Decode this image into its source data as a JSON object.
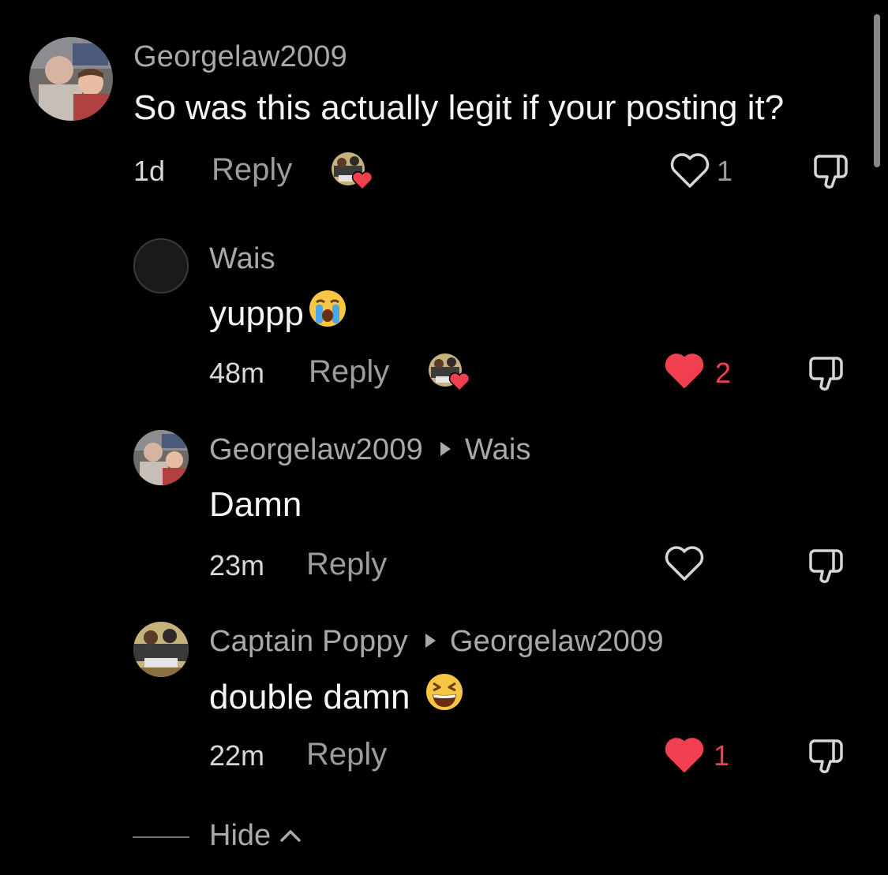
{
  "comments": [
    {
      "username": "Georgelaw2009",
      "reply_to": "",
      "text": "So was this actually legit if your posting it?",
      "emoji": "",
      "time": "1d",
      "reply_label": "Reply",
      "likes": "1",
      "liked": false,
      "creator_liked": true
    },
    {
      "username": "Wais",
      "reply_to": "",
      "text": "yuppp",
      "emoji": "loudly-crying-face",
      "time": "48m",
      "reply_label": "Reply",
      "likes": "2",
      "liked": true,
      "creator_liked": true
    },
    {
      "username": "Georgelaw2009",
      "reply_to": "Wais",
      "text": "Damn",
      "emoji": "",
      "time": "23m",
      "reply_label": "Reply",
      "likes": "",
      "liked": false,
      "creator_liked": false
    },
    {
      "username": "Captain Poppy",
      "reply_to": "Georgelaw2009",
      "text": "double damn",
      "emoji": "grinning-squinting-face",
      "time": "22m",
      "reply_label": "Reply",
      "likes": "1",
      "liked": true,
      "creator_liked": false
    }
  ],
  "hide_label": "Hide",
  "colors": {
    "background": "#000000",
    "username": "#a9a9a9",
    "text": "#f5f5f5",
    "liked_heart": "#f0404f",
    "muted": "#9c9c9c"
  },
  "icons": [
    "heart-outline-icon",
    "heart-filled-icon",
    "dislike-icon",
    "creator-liked-badge",
    "chevron-up-icon",
    "reply-arrow-icon"
  ]
}
